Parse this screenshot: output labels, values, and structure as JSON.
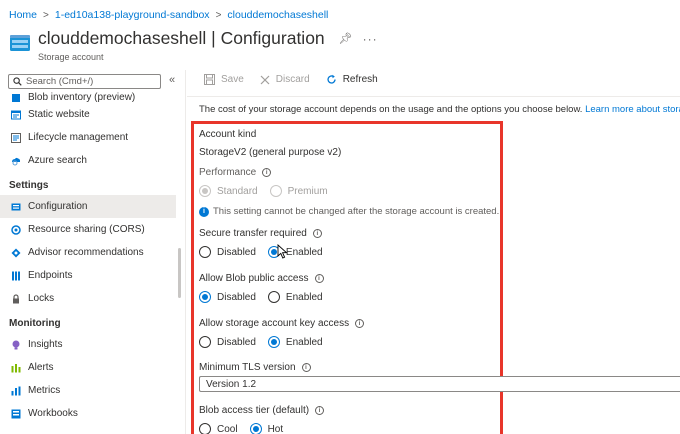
{
  "breadcrumb": [
    "Home",
    "1-ed10a138-playground-sandbox",
    "clouddemochaseshell"
  ],
  "header": {
    "title": "clouddemochaseshell | Configuration",
    "subtitle": "Storage account",
    "pin_icon": "pin-icon",
    "more": "···"
  },
  "sidebar": {
    "search_placeholder": "Search (Cmd+/)",
    "collapse": "«",
    "items_top": [
      {
        "label": "Blob inventory (preview)",
        "icon": "inventory-icon"
      },
      {
        "label": "Static website",
        "icon": "static-website-icon"
      },
      {
        "label": "Lifecycle management",
        "icon": "lifecycle-icon"
      },
      {
        "label": "Azure search",
        "icon": "azure-search-icon"
      }
    ],
    "section_settings": "Settings",
    "items_settings": [
      {
        "label": "Configuration",
        "icon": "configuration-icon",
        "active": true
      },
      {
        "label": "Resource sharing (CORS)",
        "icon": "cors-icon"
      },
      {
        "label": "Advisor recommendations",
        "icon": "advisor-icon"
      },
      {
        "label": "Endpoints",
        "icon": "endpoints-icon"
      },
      {
        "label": "Locks",
        "icon": "lock-icon"
      }
    ],
    "section_monitoring": "Monitoring",
    "items_monitoring": [
      {
        "label": "Insights",
        "icon": "insights-icon"
      },
      {
        "label": "Alerts",
        "icon": "alerts-icon"
      },
      {
        "label": "Metrics",
        "icon": "metrics-icon"
      },
      {
        "label": "Workbooks",
        "icon": "workbooks-icon"
      }
    ]
  },
  "toolbar": {
    "save": "Save",
    "discard": "Discard",
    "refresh": "Refresh"
  },
  "content": {
    "info_text": "The cost of your storage account depends on the usage and the options you choose below.",
    "info_link": "Learn more about storage"
  },
  "form": {
    "account_kind_label": "Account kind",
    "account_kind_value": "StorageV2 (general purpose v2)",
    "performance_label": "Performance",
    "performance_options": [
      "Standard",
      "Premium"
    ],
    "performance_selected": "Standard",
    "performance_notice": "This setting cannot be changed after the storage account is created.",
    "secure_transfer_label": "Secure transfer required",
    "secure_transfer_options": [
      "Disabled",
      "Enabled"
    ],
    "secure_transfer_selected": "Enabled",
    "blob_public_label": "Allow Blob public access",
    "blob_public_options": [
      "Disabled",
      "Enabled"
    ],
    "blob_public_selected": "Disabled",
    "key_access_label": "Allow storage account key access",
    "key_access_options": [
      "Disabled",
      "Enabled"
    ],
    "key_access_selected": "Enabled",
    "tls_label": "Minimum TLS version",
    "tls_value": "Version 1.2",
    "tier_label": "Blob access tier (default)",
    "tier_options": [
      "Cool",
      "Hot"
    ],
    "tier_selected": "Hot"
  },
  "colors": {
    "accent": "#0078d4",
    "highlight_border": "#e8352a",
    "active_nav": "#edebe9"
  }
}
